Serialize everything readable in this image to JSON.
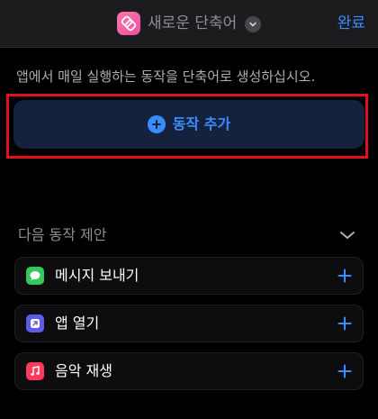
{
  "header": {
    "title": "새로운 단축어",
    "done_label": "완료",
    "app_icon": "shortcuts-icon",
    "accent_color": "#3a8dff"
  },
  "description": "앱에서 매일 실행하는 동작을 단축어로 생성하십시오.",
  "add_action": {
    "label": "동작 추가",
    "icon": "plus-circle-icon",
    "highlight_color": "#e0101c"
  },
  "suggestions": {
    "title": "다음 동작 제안",
    "items": [
      {
        "label": "메시지 보내기",
        "icon": "messages-icon",
        "icon_color": "#34c759"
      },
      {
        "label": "앱 열기",
        "icon": "open-app-icon",
        "icon_color": "#5e5ce6"
      },
      {
        "label": "음악 재생",
        "icon": "music-icon",
        "icon_color": "#ff3b5c"
      }
    ]
  }
}
